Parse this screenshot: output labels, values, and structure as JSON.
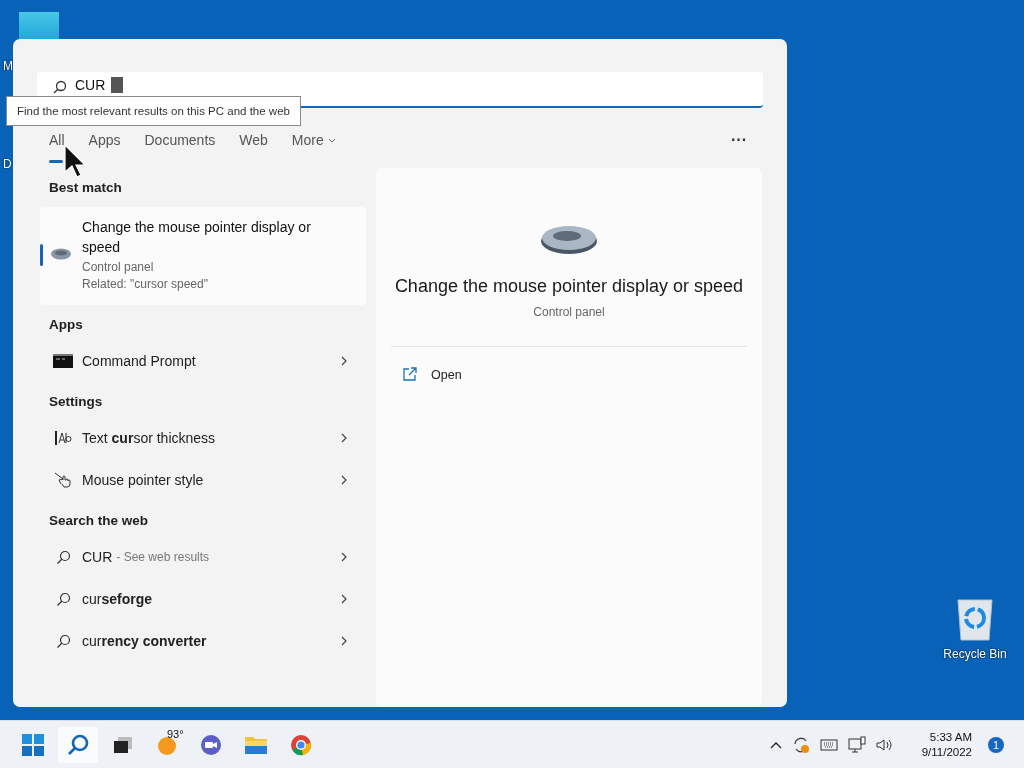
{
  "desktop": {
    "icons": [
      {
        "label": "M"
      },
      {
        "label": "D"
      },
      {
        "label": "Recycle Bin"
      }
    ]
  },
  "search": {
    "query": "CUR",
    "tooltip": "Find the most relevant results on this PC and the web"
  },
  "tabs": [
    {
      "label": "All",
      "selected": true
    },
    {
      "label": "Apps",
      "selected": false
    },
    {
      "label": "Documents",
      "selected": false
    },
    {
      "label": "Web",
      "selected": false
    },
    {
      "label": "More",
      "selected": false,
      "dropdown": true
    }
  ],
  "more_options": "···",
  "best_match": {
    "heading": "Best match",
    "title": "Change the mouse pointer display or speed",
    "type": "Control panel",
    "related": "Related: \"cursor speed\"",
    "selected": true
  },
  "sections": [
    {
      "heading": "Apps",
      "items": [
        {
          "kind": "cmd",
          "label": "Command Prompt"
        }
      ]
    },
    {
      "heading": "Settings",
      "items": [
        {
          "kind": "textcursor",
          "label": "Text **cur**sor thickness"
        },
        {
          "kind": "pointer",
          "label": "Mouse pointer style"
        }
      ]
    },
    {
      "heading": "Search the web",
      "items": [
        {
          "kind": "web",
          "label": "CUR",
          "note": "- See web results"
        },
        {
          "kind": "web",
          "label": "cur**seforge**"
        },
        {
          "kind": "web",
          "label": "cur**rency converter**"
        }
      ]
    }
  ],
  "preview": {
    "title": "Change the mouse pointer display or speed",
    "subtitle": "Control panel",
    "actions": [
      {
        "label": "Open"
      }
    ]
  },
  "taskbar": {
    "weather": "93°",
    "time": "5:33 AM",
    "date": "9/11/2022",
    "notifications": "1"
  }
}
